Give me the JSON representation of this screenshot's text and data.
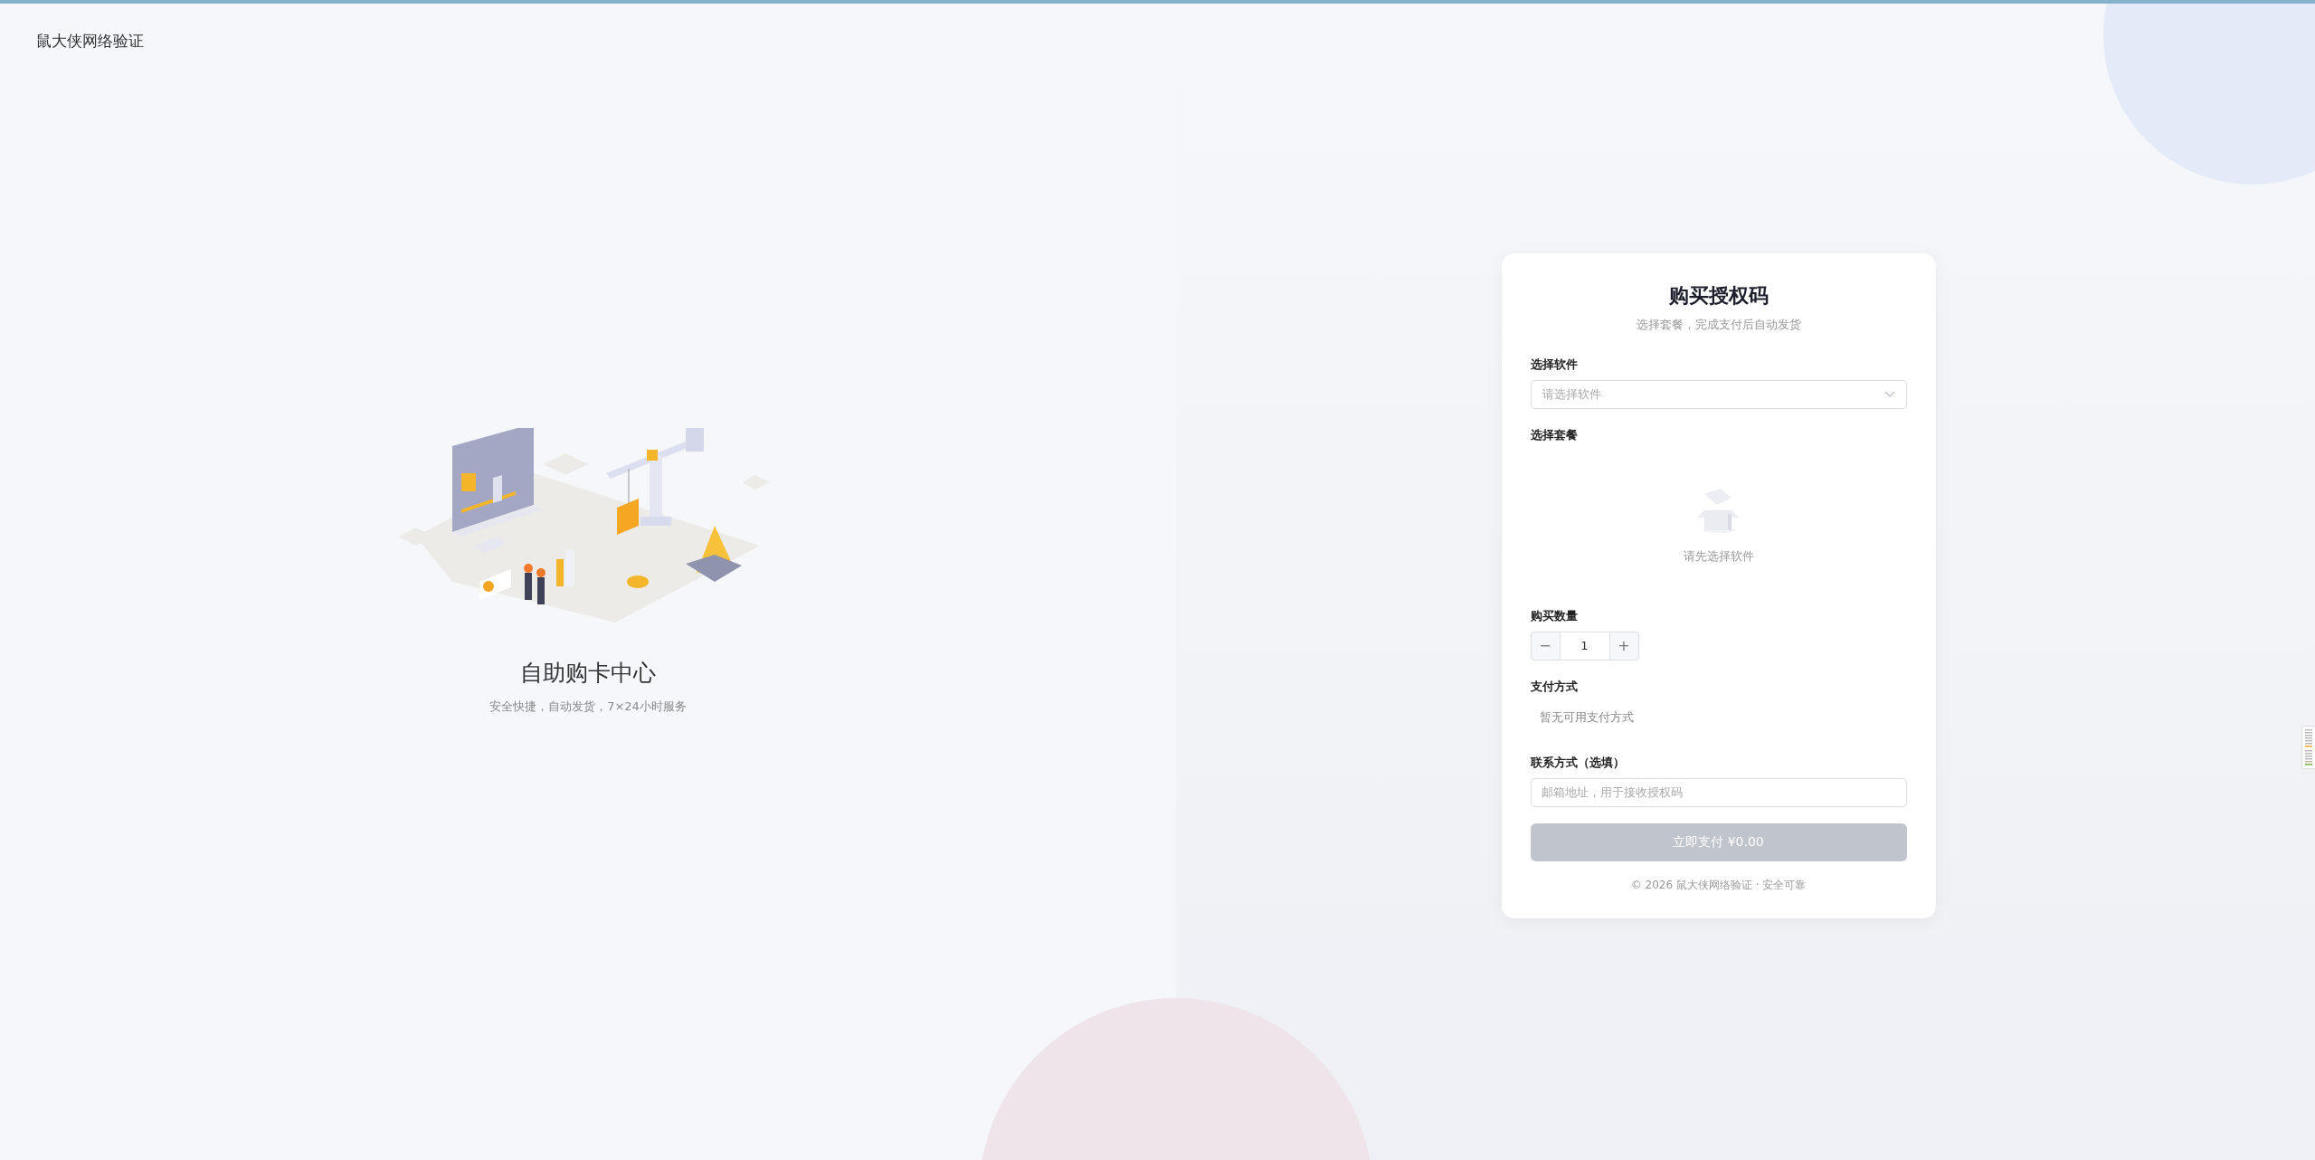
{
  "brand": "鼠大侠网络验证",
  "hero": {
    "title": "自助购卡中心",
    "subtitle": "安全快捷，自动发货，7×24小时服务"
  },
  "card": {
    "title": "购买授权码",
    "subtitle": "选择套餐，完成支付后自动发货",
    "software": {
      "label": "选择软件",
      "placeholder": "请选择软件"
    },
    "plan": {
      "label": "选择套餐",
      "empty_text": "请先选择软件"
    },
    "quantity": {
      "label": "购买数量",
      "value": "1",
      "minus": "−",
      "plus": "+"
    },
    "payment": {
      "label": "支付方式",
      "empty_text": "暂无可用支付方式"
    },
    "contact": {
      "label": "联系方式（选填）",
      "placeholder": "邮箱地址，用于接收授权码"
    },
    "pay_button": {
      "label": "立即支付 ¥0.00",
      "disabled": true
    },
    "footer": "© 2026 鼠大侠网络验证 · 安全可靠"
  }
}
